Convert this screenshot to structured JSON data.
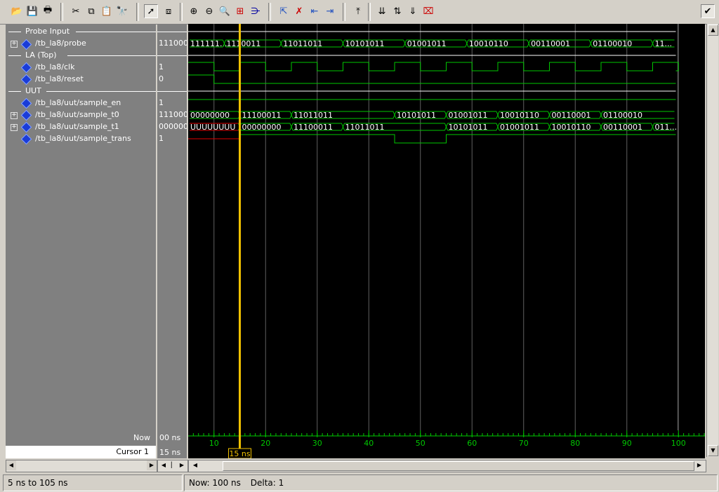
{
  "toolbar": {
    "buttons": [
      "open-icon",
      "save-icon",
      "print-icon",
      "cut-icon",
      "copy-icon",
      "paste-icon",
      "find-icon",
      "select-arrow-icon",
      "zoom-area-icon",
      "zoom-in-icon",
      "zoom-out-icon",
      "zoom-full-icon",
      "insert-cursor-icon",
      "delete-cursor-icon",
      "previous-edge-icon",
      "next-edge-icon",
      "add-signal-icon",
      "expand-icon",
      "collapse-icon",
      "sort-icon",
      "delete-signal-icon",
      "dock-icon"
    ]
  },
  "groups": [
    {
      "label": "Probe Input"
    },
    {
      "label": "LA (Top)"
    },
    {
      "label": "UUT"
    }
  ],
  "signals": [
    {
      "name": "/tb_la8/probe",
      "value": "111000",
      "bus": true
    },
    {
      "name": "/tb_la8/clk",
      "value": "1",
      "bus": false
    },
    {
      "name": "/tb_la8/reset",
      "value": "0",
      "bus": false
    },
    {
      "name": "/tb_la8/uut/sample_en",
      "value": "1",
      "bus": false
    },
    {
      "name": "/tb_la8/uut/sample_t0",
      "value": "111000",
      "bus": true
    },
    {
      "name": "/tb_la8/uut/sample_t1",
      "value": "000000",
      "bus": true
    },
    {
      "name": "/tb_la8/uut/sample_trans",
      "value": "1",
      "bus": false
    }
  ],
  "waves": {
    "time_start": 5,
    "time_end": 105,
    "probe": [
      {
        "t": 5,
        "label": "111111..."
      },
      {
        "t": 12,
        "label": "1110011"
      },
      {
        "t": 23,
        "label": "11011011"
      },
      {
        "t": 35,
        "label": "10101011"
      },
      {
        "t": 47,
        "label": "01001011"
      },
      {
        "t": 59,
        "label": "10010110"
      },
      {
        "t": 71,
        "label": "00110001"
      },
      {
        "t": 83,
        "label": "01100010"
      },
      {
        "t": 95,
        "label": "11..."
      }
    ],
    "clk": {
      "first_edge": 5,
      "half_period": 2.5
    },
    "reset": {
      "high_until": 10
    },
    "sample_t0": [
      {
        "t": 5,
        "label": "00000000"
      },
      {
        "t": 15,
        "label": "11100011"
      },
      {
        "t": 25,
        "label": "11011011"
      },
      {
        "t": 45,
        "label": "10101011"
      },
      {
        "t": 55,
        "label": "01001011"
      },
      {
        "t": 65,
        "label": "10010110"
      },
      {
        "t": 75,
        "label": "00110001"
      },
      {
        "t": 85,
        "label": "01100010"
      }
    ],
    "sample_t1": [
      {
        "t": 5,
        "label": "UUUUUUUU",
        "undefined": true
      },
      {
        "t": 15,
        "label": "00000000"
      },
      {
        "t": 25,
        "label": "11100011"
      },
      {
        "t": 35,
        "label": "11011011"
      },
      {
        "t": 55,
        "label": "10101011"
      },
      {
        "t": 65,
        "label": "01001011"
      },
      {
        "t": 75,
        "label": "10010110"
      },
      {
        "t": 85,
        "label": "00110001"
      },
      {
        "t": 95,
        "label": "011..."
      }
    ],
    "sample_trans": {
      "low_from": 45,
      "low_to": 55
    }
  },
  "timeline": {
    "ticks": [
      "10",
      "20",
      "30",
      "40",
      "50",
      "60",
      "70",
      "80",
      "90",
      "100"
    ],
    "tick_values": [
      10,
      20,
      30,
      40,
      50,
      60,
      70,
      80,
      90,
      100
    ]
  },
  "cursor": {
    "time": 15,
    "label": "15 ns"
  },
  "now": {
    "label": "Now",
    "value": "00 ns"
  },
  "cursor_row": {
    "label": "Cursor 1",
    "value": "15 ns"
  },
  "status": {
    "range": "5 ns to 105 ns",
    "now": "Now: 100 ns",
    "delta": "Delta: 1"
  },
  "colors": {
    "wave": "#00c800",
    "cursor": "#f0c000",
    "undefined": "#e00000",
    "grid": "#606060"
  }
}
